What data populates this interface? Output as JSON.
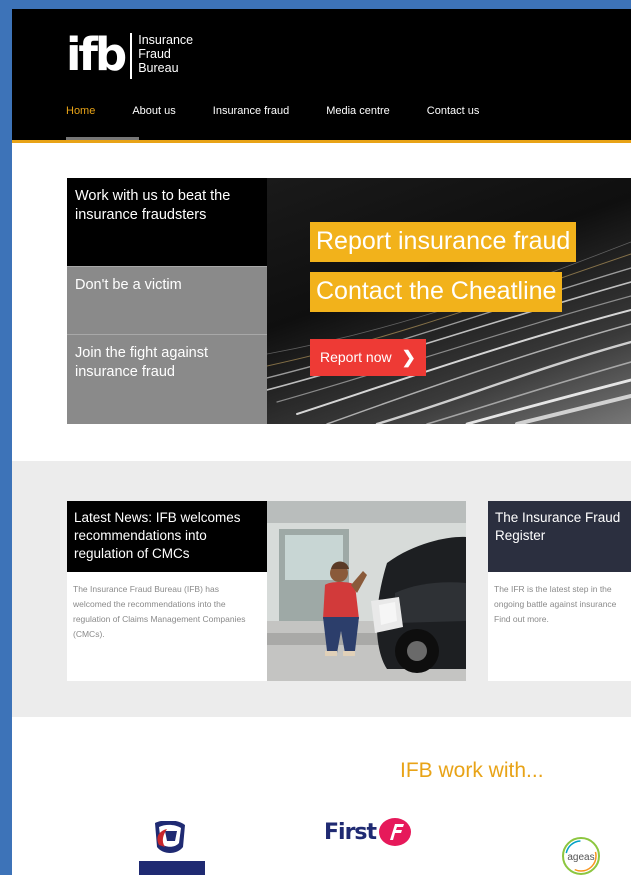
{
  "header": {
    "logo_mark": "ifb",
    "logo_words": [
      "Insurance",
      "Fraud",
      "Bureau"
    ],
    "nav": [
      {
        "label": "Home",
        "active": true
      },
      {
        "label": "About us"
      },
      {
        "label": "Insurance fraud"
      },
      {
        "label": "Media centre"
      },
      {
        "label": "Contact us"
      }
    ]
  },
  "hero": {
    "side_items": [
      "Work with us to beat the insurance fraudsters",
      "Don't be a victim",
      "Join the fight against insurance fraud"
    ],
    "tag_1": "Report insurance fraud",
    "tag_2": "Contact the Cheatline",
    "report_button": "Report now"
  },
  "news": {
    "card_1": {
      "title": "Latest News: IFB welcomes recommendations into regulation of CMCs",
      "text": "The Insurance Fraud Bureau (IFB) has welcomed the recommendations into the regulation of Claims Management Companies (CMCs)."
    },
    "card_2": {
      "title_lines": [
        "The Insurance Fraud",
        "Register"
      ],
      "text_lines": [
        "The IFR is the latest step in the",
        "ongoing battle against insurance",
        "Find out more."
      ]
    }
  },
  "partners": {
    "title": "IFB work with...",
    "logos": [
      {
        "name": "Aviva-style-crest-icon"
      },
      {
        "text": "First",
        "icon": "first-f-icon"
      },
      {
        "text": "ageas",
        "icon": "ageas-ring-icon"
      }
    ]
  },
  "colors": {
    "accent": "#e8a317",
    "cta_red": "#ee3a35",
    "tag_yellow": "#f2b21b",
    "frame_blue": "#3d73b8",
    "dark_navy": "#2b2f3f"
  }
}
